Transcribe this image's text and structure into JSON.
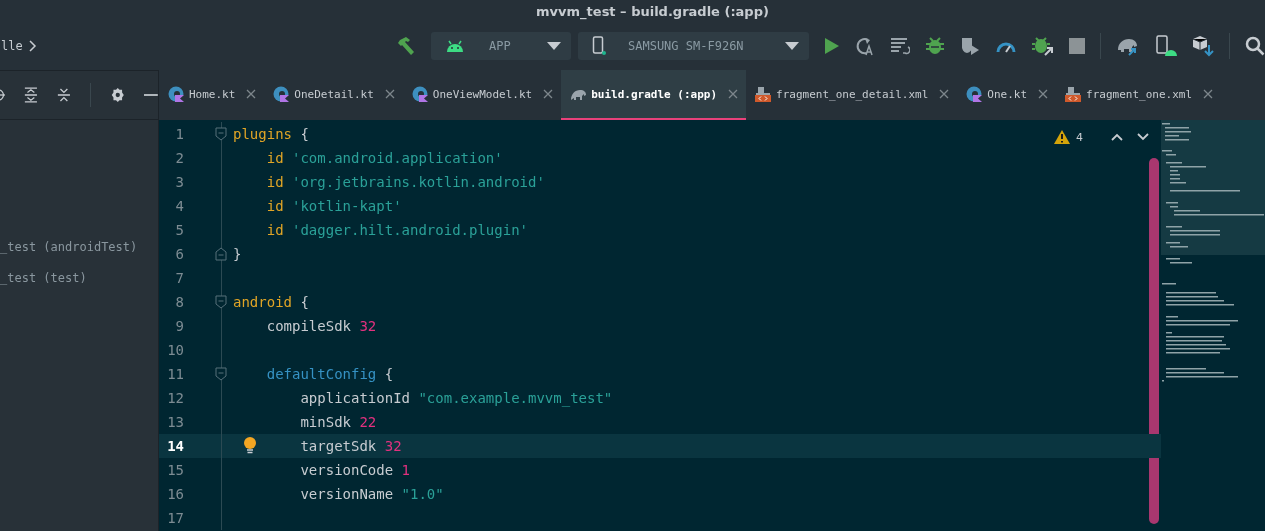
{
  "window": {
    "title": "mvvm_test – build.gradle (:app)"
  },
  "breadcrumb": {
    "text": "lle"
  },
  "run_config": {
    "label": "APP"
  },
  "device": {
    "label": "SAMSUNG SM-F926N"
  },
  "project_panel": {
    "items": [
      {
        "label": "_test (androidTest)"
      },
      {
        "label": "_test (test)"
      }
    ]
  },
  "tabs": [
    {
      "label": "Home.kt",
      "kind": "kotlin",
      "selected": false
    },
    {
      "label": "OneDetail.kt",
      "kind": "kotlin",
      "selected": false
    },
    {
      "label": "OneViewModel.kt",
      "kind": "kotlin",
      "selected": false
    },
    {
      "label": "build.gradle (:app)",
      "kind": "gradle",
      "selected": true
    },
    {
      "label": "fragment_one_detail.xml",
      "kind": "xml",
      "selected": false
    },
    {
      "label": "One.kt",
      "kind": "kotlin",
      "selected": false
    },
    {
      "label": "fragment_one.xml",
      "kind": "xml",
      "selected": false
    }
  ],
  "editor": {
    "warning_count": "4",
    "lines": [
      {
        "number": "1",
        "current": false,
        "fold_start": true,
        "fold_end": false,
        "bulb": false,
        "tokens": [
          {
            "text": "plugins",
            "kind": "keyword"
          },
          {
            "text": " {",
            "kind": "plain"
          }
        ]
      },
      {
        "number": "2",
        "current": false,
        "fold_start": false,
        "fold_end": false,
        "bulb": false,
        "tokens": [
          {
            "text": "    id ",
            "kind": "keyword"
          },
          {
            "text": "'com.android.application'",
            "kind": "string"
          }
        ]
      },
      {
        "number": "3",
        "current": false,
        "fold_start": false,
        "fold_end": false,
        "bulb": false,
        "tokens": [
          {
            "text": "    id ",
            "kind": "keyword"
          },
          {
            "text": "'org.jetbrains.kotlin.android'",
            "kind": "string"
          }
        ]
      },
      {
        "number": "4",
        "current": false,
        "fold_start": false,
        "fold_end": false,
        "bulb": false,
        "tokens": [
          {
            "text": "    id ",
            "kind": "keyword"
          },
          {
            "text": "'kotlin-kapt'",
            "kind": "string"
          }
        ]
      },
      {
        "number": "5",
        "current": false,
        "fold_start": false,
        "fold_end": false,
        "bulb": false,
        "tokens": [
          {
            "text": "    id ",
            "kind": "keyword"
          },
          {
            "text": "'dagger.hilt.android.plugin'",
            "kind": "string"
          }
        ]
      },
      {
        "number": "6",
        "current": false,
        "fold_start": false,
        "fold_end": true,
        "bulb": false,
        "tokens": [
          {
            "text": "}",
            "kind": "plain"
          }
        ]
      },
      {
        "number": "7",
        "current": false,
        "fold_start": false,
        "fold_end": false,
        "bulb": false
      },
      {
        "number": "8",
        "current": false,
        "fold_start": true,
        "fold_end": false,
        "bulb": false,
        "tokens": [
          {
            "text": "android",
            "kind": "keyword"
          },
          {
            "text": " {",
            "kind": "plain"
          }
        ]
      },
      {
        "number": "9",
        "current": false,
        "fold_start": false,
        "fold_end": false,
        "bulb": false,
        "tokens": [
          {
            "text": "    compileSdk ",
            "kind": "plain"
          },
          {
            "text": "32",
            "kind": "number"
          }
        ]
      },
      {
        "number": "10",
        "current": false,
        "fold_start": false,
        "fold_end": false,
        "bulb": false
      },
      {
        "number": "11",
        "current": false,
        "fold_start": true,
        "fold_end": false,
        "bulb": false,
        "tokens": [
          {
            "text": "    defaultConfig",
            "kind": "method"
          },
          {
            "text": " {",
            "kind": "plain"
          }
        ]
      },
      {
        "number": "12",
        "current": false,
        "fold_start": false,
        "fold_end": false,
        "bulb": false,
        "tokens": [
          {
            "text": "        applicationId ",
            "kind": "plain"
          },
          {
            "text": "\"com.example.mvvm_test\"",
            "kind": "string"
          }
        ]
      },
      {
        "number": "13",
        "current": false,
        "fold_start": false,
        "fold_end": false,
        "bulb": false,
        "tokens": [
          {
            "text": "        minSdk ",
            "kind": "plain"
          },
          {
            "text": "22",
            "kind": "number"
          }
        ]
      },
      {
        "number": "14",
        "current": true,
        "fold_start": false,
        "fold_end": false,
        "bulb": true,
        "tokens": [
          {
            "text": "        targetSdk ",
            "kind": "plain"
          },
          {
            "text": "32",
            "kind": "number"
          }
        ]
      },
      {
        "number": "15",
        "current": false,
        "fold_start": false,
        "fold_end": false,
        "bulb": false,
        "tokens": [
          {
            "text": "        versionCode ",
            "kind": "plain"
          },
          {
            "text": "1",
            "kind": "number"
          }
        ]
      },
      {
        "number": "16",
        "current": false,
        "fold_start": false,
        "fold_end": false,
        "bulb": false,
        "tokens": [
          {
            "text": "        versionName ",
            "kind": "plain"
          },
          {
            "text": "\"1.0\"",
            "kind": "string"
          }
        ]
      },
      {
        "number": "17",
        "current": false,
        "fold_start": false,
        "fold_end": false,
        "bulb": false
      }
    ]
  }
}
